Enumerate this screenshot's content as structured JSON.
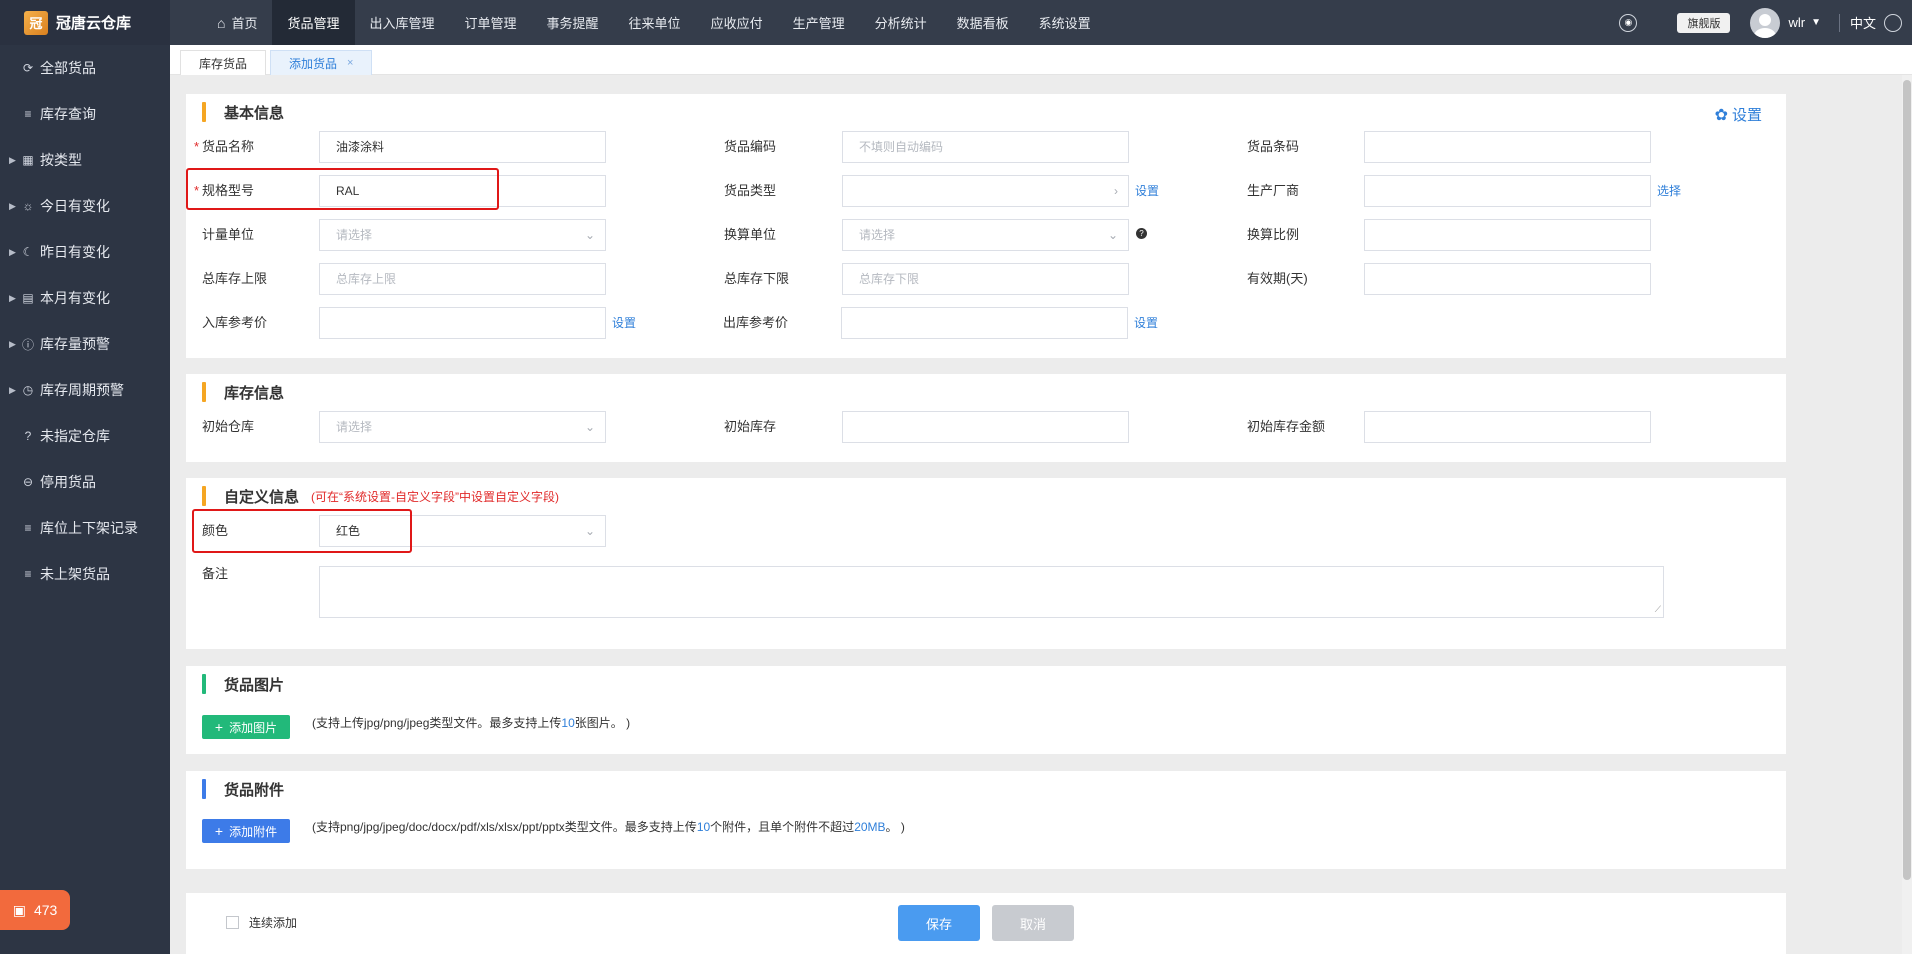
{
  "app": {
    "name": "冠唐云仓库",
    "logo_glyph": "冠"
  },
  "sidebar": {
    "items": [
      {
        "label": "全部货品",
        "icon": "refresh-icon",
        "glyph": "⟳",
        "expandable": false
      },
      {
        "label": "库存查询",
        "icon": "list-icon",
        "glyph": "≡",
        "expandable": false
      },
      {
        "label": "按类型",
        "icon": "grid-icon",
        "glyph": "▦",
        "expandable": true
      },
      {
        "label": "今日有变化",
        "icon": "sun-icon",
        "glyph": "☼",
        "expandable": true
      },
      {
        "label": "昨日有变化",
        "icon": "moon-icon",
        "glyph": "☾",
        "expandable": true
      },
      {
        "label": "本月有变化",
        "icon": "calendar-icon",
        "glyph": "▤",
        "expandable": true
      },
      {
        "label": "库存量预警",
        "icon": "alert-icon",
        "glyph": "ⓘ",
        "expandable": true
      },
      {
        "label": "库存周期预警",
        "icon": "clock-icon",
        "glyph": "◷",
        "expandable": true
      },
      {
        "label": "未指定仓库",
        "icon": "question-icon",
        "glyph": "?",
        "expandable": false
      },
      {
        "label": "停用货品",
        "icon": "minus-circle-icon",
        "glyph": "⊖",
        "expandable": false
      },
      {
        "label": "库位上下架记录",
        "icon": "list-icon",
        "glyph": "≡",
        "expandable": false
      },
      {
        "label": "未上架货品",
        "icon": "list-icon",
        "glyph": "≡",
        "expandable": false
      }
    ],
    "badge": {
      "count": "473",
      "icon": "gift-icon"
    }
  },
  "topnav": {
    "items": [
      "首页",
      "货品管理",
      "出入库管理",
      "订单管理",
      "事务提醒",
      "往来单位",
      "应收应付",
      "生产管理",
      "分析统计",
      "数据看板",
      "系统设置"
    ],
    "active_index": 1,
    "edition": "旗舰版",
    "username": "wlr",
    "language": "中文"
  },
  "tabs": [
    {
      "label": "库存货品",
      "active": false
    },
    {
      "label": "添加货品",
      "active": true,
      "close": "×"
    }
  ],
  "basic": {
    "title": "基本信息",
    "settings": "设置",
    "fields": {
      "name": {
        "label": "货品名称",
        "value": "油漆涂料",
        "required": "*"
      },
      "code": {
        "label": "货品编码",
        "placeholder": "不填则自动编码"
      },
      "barcode": {
        "label": "货品条码"
      },
      "spec": {
        "label": "规格型号",
        "value": "RAL",
        "required": "*"
      },
      "type": {
        "label": "货品类型",
        "link": "设置"
      },
      "maker": {
        "label": "生产厂商",
        "link": "选择"
      },
      "unit": {
        "label": "计量单位",
        "placeholder": "请选择"
      },
      "conv_unit": {
        "label": "换算单位",
        "placeholder": "请选择"
      },
      "conv_ratio": {
        "label": "换算比例"
      },
      "max_stock": {
        "label": "总库存上限",
        "placeholder": "总库存上限"
      },
      "min_stock": {
        "label": "总库存下限",
        "placeholder": "总库存下限"
      },
      "expiry": {
        "label": "有效期(天)"
      },
      "in_price": {
        "label": "入库参考价",
        "link": "设置"
      },
      "out_price": {
        "label": "出库参考价",
        "link": "设置"
      }
    }
  },
  "stock": {
    "title": "库存信息",
    "fields": {
      "warehouse": {
        "label": "初始仓库",
        "placeholder": "请选择"
      },
      "qty": {
        "label": "初始库存"
      },
      "amount": {
        "label": "初始库存金额"
      }
    }
  },
  "custom": {
    "title": "自定义信息",
    "hint": "(可在“系统设置-自定义字段”中设置自定义字段)",
    "color": {
      "label": "颜色",
      "value": "红色"
    },
    "remark": {
      "label": "备注"
    }
  },
  "images": {
    "title": "货品图片",
    "button": "添加图片",
    "note_pre": "(支持上传jpg/png/jpeg类型文件。最多支持上传",
    "note_num": "10",
    "note_post": "张图片。 )"
  },
  "attachments": {
    "title": "货品附件",
    "button": "添加附件",
    "note_pre": "(支持png/jpg/jpeg/doc/docx/pdf/xls/xlsx/ppt/pptx类型文件。最多支持上传",
    "note_num": "10",
    "note_mid": "个附件，且单个附件不超过",
    "note_size": "20MB",
    "note_post": "。 )"
  },
  "footer": {
    "continuous": "连续添加",
    "save": "保存",
    "cancel": "取消"
  },
  "colors": {
    "primary": "#2f7fd9",
    "orange_bar": "#f5a623",
    "green": "#22b97a",
    "blue_btn": "#3d7be8",
    "required": "#e12a2a"
  }
}
